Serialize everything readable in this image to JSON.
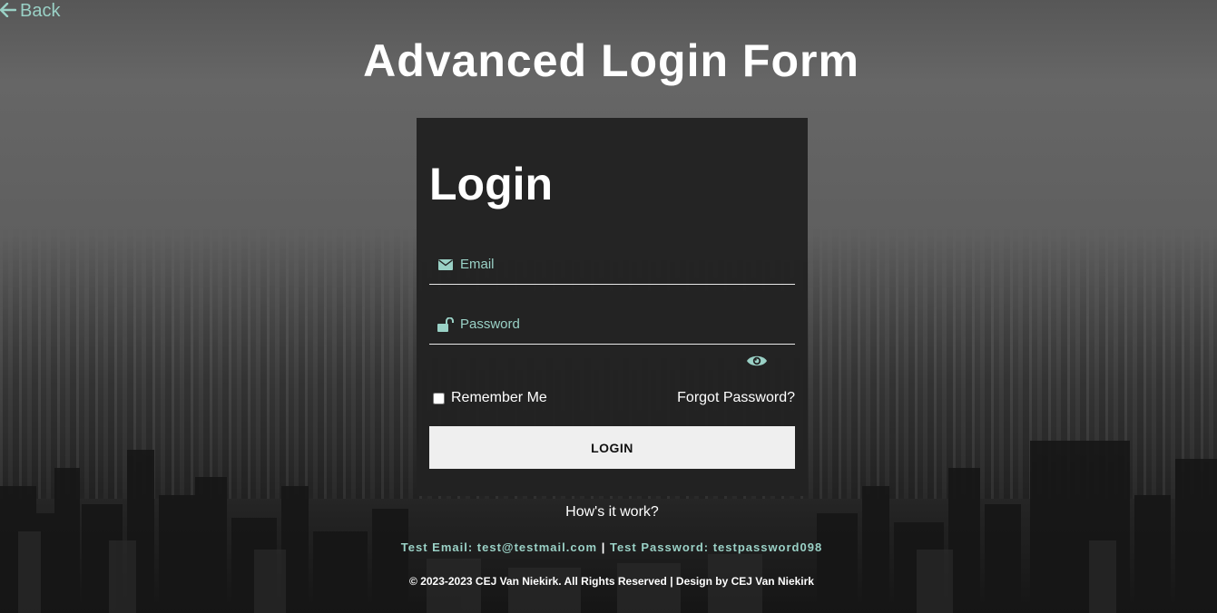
{
  "nav": {
    "back_label": "Back"
  },
  "page": {
    "title": "Advanced Login Form"
  },
  "login_card": {
    "title": "Login",
    "email_placeholder": "Email",
    "password_placeholder": "Password",
    "remember_label": "Remember Me",
    "remember_checked": false,
    "forgot_label": "Forgot Password?",
    "login_button_label": "LOGIN"
  },
  "info": {
    "how_label": "How's it work?",
    "test_email": "Test Email: test@testmail.com",
    "separator": "|",
    "test_password": "Test Password: testpassword098",
    "footer": "© 2023-2023 CEJ Van Niekirk. All Rights Reserved | Design by CEJ Van Niekirk"
  },
  "icons": {
    "back": "arrow-left-icon",
    "email": "envelope-icon",
    "password": "unlock-icon",
    "toggle": "eye-icon"
  },
  "colors": {
    "accent": "#9ad1c6",
    "card_bg": "#222222",
    "button_bg": "#efefef",
    "text": "#ffffff"
  }
}
